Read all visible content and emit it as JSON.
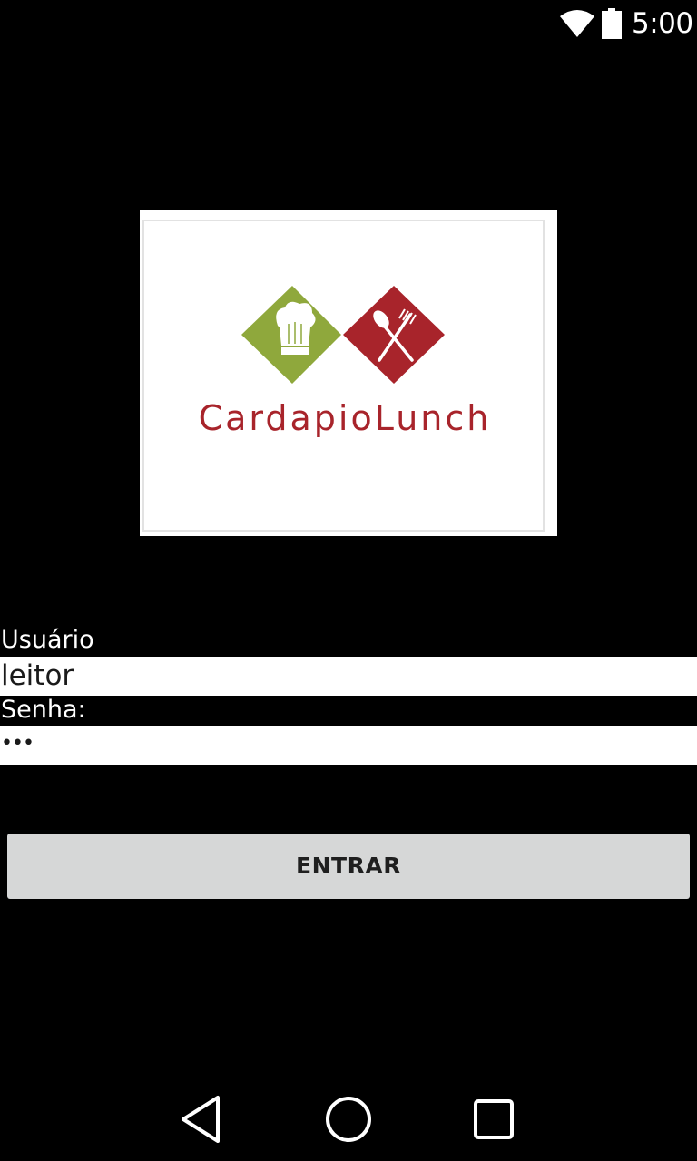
{
  "status_bar": {
    "time": "5:00",
    "wifi_icon": "wifi-icon",
    "battery_icon": "battery-full-icon"
  },
  "logo": {
    "text": "CardapioLunch",
    "brand_green": "#8fa83c",
    "brand_red": "#a8242b",
    "chef_hat_icon": "chef-hat-icon",
    "fork_spoon_icon": "fork-spoon-icon"
  },
  "form": {
    "user_label": "Usuário",
    "user_value": "leitor",
    "password_label": "Senha:",
    "password_value": "•••"
  },
  "login_button": {
    "label": "ENTRAR"
  },
  "nav_bar": {
    "back_icon": "back-icon",
    "home_icon": "home-icon",
    "recent_apps_icon": "recent-apps-icon"
  }
}
